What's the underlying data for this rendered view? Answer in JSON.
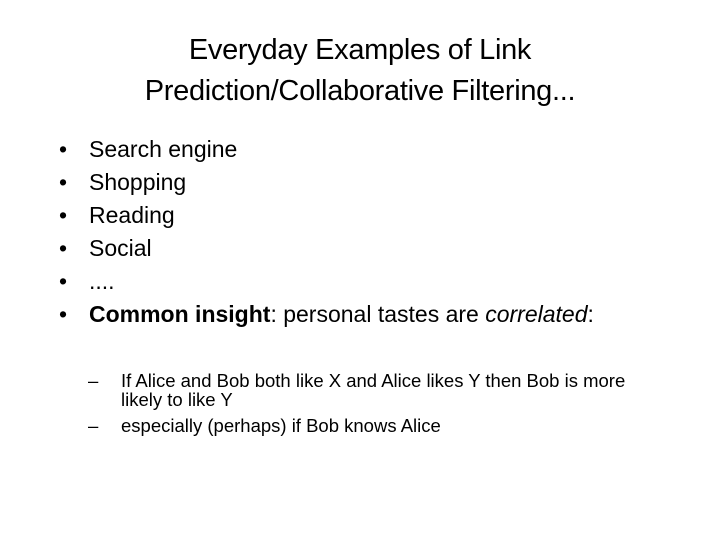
{
  "slide": {
    "title_lines": [
      "Everyday Examples of Link",
      "Prediction/Collaborative Filtering..."
    ],
    "bullets": [
      "Search engine",
      "Shopping",
      "Reading",
      "Social",
      "...."
    ],
    "insight": {
      "bold": "Common insight",
      "text1": ": personal tastes are ",
      "italic": "correlated",
      "text2": ":"
    },
    "sub_bullets": [
      "If Alice and Bob both like X and Alice likes Y then Bob is more likely to like Y",
      "especially (perhaps) if Bob knows Alice"
    ],
    "bullet_glyph": "•",
    "dash_glyph": "–"
  }
}
